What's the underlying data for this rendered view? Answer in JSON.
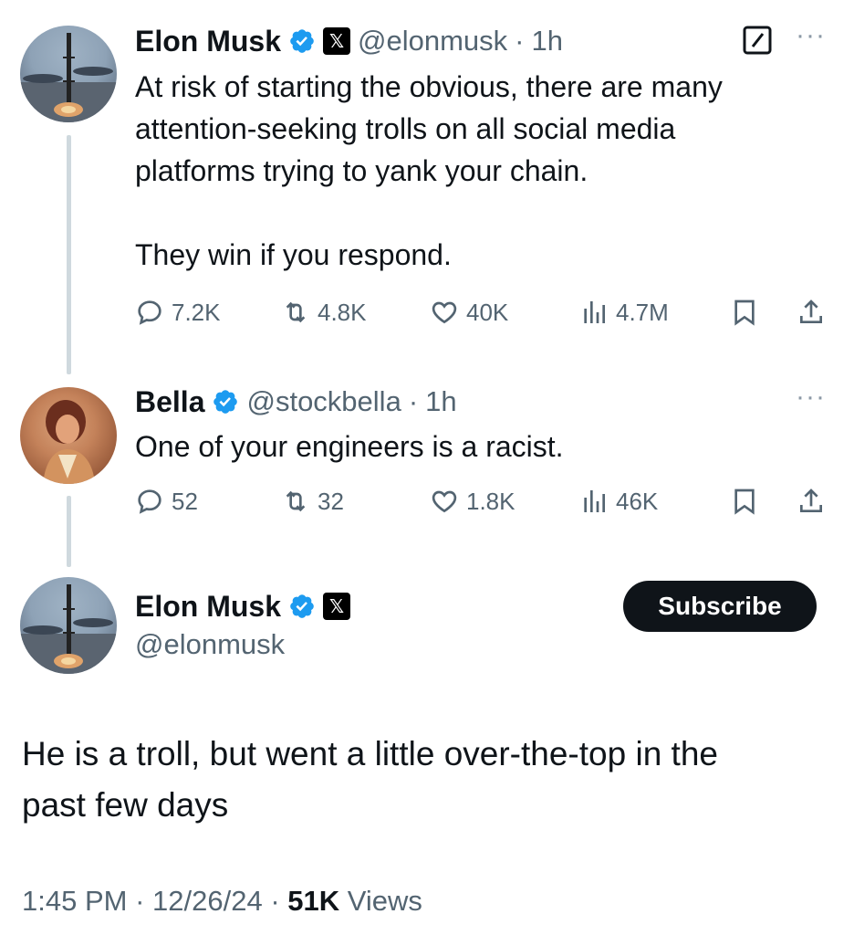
{
  "parent_tweet": {
    "name": "Elon Musk",
    "handle": "@elonmusk",
    "separator": "·",
    "time": "1h",
    "text_line1": "At risk of starting the obvious, there are many",
    "text_line2": "attention-seeking trolls on all social media",
    "text_line3": "platforms trying to yank your chain.",
    "text_line4": "They win if you respond.",
    "replies": "7.2K",
    "reposts": "4.8K",
    "likes": "40K",
    "views": "4.7M",
    "more_icon": "more-icon"
  },
  "reply_tweet": {
    "name": "Bella",
    "handle": "@stockbella",
    "separator": "·",
    "time": "1h",
    "text": "One of your engineers is a racist.",
    "replies": "52",
    "reposts": "32",
    "likes": "1.8K",
    "views": "46K"
  },
  "focused_tweet": {
    "name": "Elon Musk",
    "handle": "@elonmusk",
    "subscribe_label": "Subscribe",
    "text_line1": "He is a troll, but went a little over-the-top in the",
    "text_line2": "past few days",
    "time": "1:45 PM",
    "date": "12/26/24",
    "views_count": "51K",
    "views_label": "Views",
    "separator": "·"
  },
  "colors": {
    "verified_blue": "#1d9bf0",
    "text_primary": "#0f1419",
    "text_secondary": "#536471",
    "thread_line": "#cfd9de"
  }
}
